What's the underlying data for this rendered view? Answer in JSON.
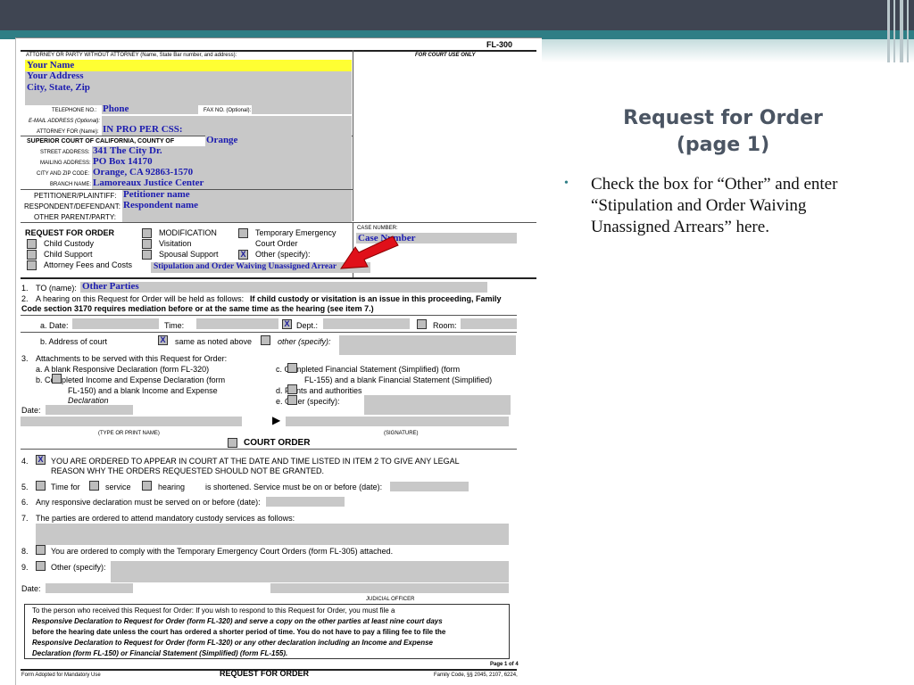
{
  "slide": {
    "title_line1": "Request for Order",
    "title_line2": "(page 1)",
    "bullet": "Check the box for “Other” and enter “Stipulation and Order Waiving Unassigned Arrears” here."
  },
  "form": {
    "form_number": "FL-300",
    "attorney_label": "ATTORNEY OR PARTY WITHOUT ATTORNEY (Name, State Bar number, and address):",
    "court_use_label": "FOR COURT USE ONLY",
    "name": "Your Name",
    "address": "Your Address",
    "city": "City, State, Zip",
    "telephone_label": "TELEPHONE NO.:",
    "telephone": "Phone",
    "fax_label": "FAX NO. (Optional):",
    "email_label": "E-MAIL ADDRESS (Optional):",
    "attorney_for_label": "ATTORNEY FOR (Name):",
    "attorney_for": "IN PRO PER     CSS:",
    "court_label": "SUPERIOR COURT OF CALIFORNIA, COUNTY OF",
    "county": "Orange",
    "street_label": "STREET ADDRESS:",
    "street": "341 The City Dr.",
    "mailing_label": "MAILING ADDRESS:",
    "mailing": "PO Box 14170",
    "cityzip_label": "CITY AND ZIP CODE:",
    "cityzip": "Orange, CA  92863-1570",
    "branch_label": "BRANCH NAME:",
    "branch": "Lamoreaux Justice Center",
    "petitioner_label": "PETITIONER/PLAINTIFF:",
    "petitioner": "Petitioner name",
    "respondent_label": "RESPONDENT/DEFENDANT:",
    "respondent": "Respondent name",
    "other_parent_label": "OTHER PARENT/PARTY:",
    "rfo_label": "REQUEST FOR ORDER",
    "modification": "MODIFICATION",
    "temp_emergency": "Temporary Emergency",
    "court_order": "Court Order",
    "child_custody": "Child Custody",
    "visitation": "Visitation",
    "child_support": "Child Support",
    "spousal_support": "Spousal Support",
    "other_specify": "Other (specify):",
    "attorney_fees": "Attorney Fees and Costs",
    "other_text": "Stipulation and Order Waiving Unassigned Arrear",
    "case_number_label": "CASE NUMBER:",
    "case_number": "Case Number",
    "item1_num": "1.",
    "item1_label": "TO (name):",
    "item1_value": "Other Parties",
    "item2_num": "2.",
    "item2_line1_a": "A hearing on this Request for Order will be held as follows:",
    "item2_line1_b": "If child custody or visitation is an issue in this proceeding, Family",
    "item2_line2": "Code section 3170 requires mediation before or at the same time as the hearing (see item 7.)",
    "date_label": "a.  Date:",
    "time_label": "Time:",
    "dept_label": "Dept.:",
    "room_label": "Room:",
    "address_court_label": "b.  Address of court",
    "same_as_noted": "same as noted above",
    "other_specify_lc": "other (specify):",
    "item3_num": "3.",
    "item3_label": "Attachments to be served with this Request for Order:",
    "item3a": "a.   A blank Responsive Declaration (form FL-320)",
    "item3b1": "b.         Completed Income and Expense Declaration (form",
    "item3b2": "FL-150) and a blank Income and Expense",
    "item3b3": "Declaration",
    "item3c1": "c.         Completed Financial Statement (Simplified) (form",
    "item3c2": "FL-155) and a blank Financial Statement (Simplified)",
    "item3d": "d.         Points and authorities",
    "item3e": "e.         Other (specify):",
    "date_plain": "Date:",
    "type_print_label": "(TYPE OR PRINT NAME)",
    "signature_label": "(SIGNATURE)",
    "court_order_heading": "COURT ORDER",
    "item4_num": "4.",
    "item4_line1": "YOU ARE ORDERED TO APPEAR IN COURT AT THE DATE AND TIME LISTED IN ITEM 2 TO GIVE ANY LEGAL",
    "item4_line2": "REASON WHY THE ORDERS REQUESTED SHOULD NOT BE GRANTED.",
    "item5_num": "5.",
    "item5_time": "Time for",
    "item5_service": "service",
    "item5_hearing": "hearing",
    "item5_rest": "is shortened. Service must be on or before (date):",
    "item6_num": "6.",
    "item6_text": "Any responsive declaration must be served on or before (date):",
    "item7_num": "7.",
    "item7_text": "The parties are ordered to attend mandatory custody services as follows:",
    "item8_num": "8.",
    "item8_text": "You are ordered to comply with the Temporary Emergency Court Orders (form FL-305) attached.",
    "item9_num": "9.",
    "item9_text": "Other (specify):",
    "judicial_officer": "JUDICIAL OFFICER",
    "notice_line1": "To the person who received this Request for Order: If you wish to respond to this Request for Order, you must file a",
    "notice_line2": "Responsive Declaration to Request for Order (form FL-320) and serve a copy on the other parties at least nine court days",
    "notice_line3": "before the hearing date unless the court has ordered a shorter period of time. You do not have to pay a filing fee to file the",
    "notice_line4": "Responsive Declaration to Request for Order (form FL-320) or any other declaration including an Income and Expense",
    "notice_line5": "Declaration (form FL-150) or Financial Statement (Simplified) (form FL-155).",
    "page_of": "Page 1 of 4",
    "footer_left": "Form Adopted for Mandatory Use",
    "footer_title": "REQUEST FOR ORDER",
    "footer_right": "Family Code, §§ 2045, 2107, 6224,",
    "check_x": "X"
  },
  "colors": {
    "topbar": "#3f4552",
    "teal": "#2f7e85",
    "highlight": "#ffff33",
    "fill_text": "#1b1bb0",
    "arrow": "#e0101a"
  }
}
